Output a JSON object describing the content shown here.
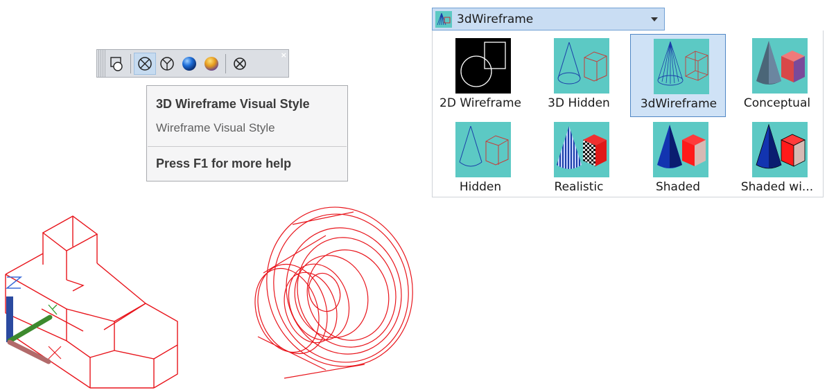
{
  "toolbar": {
    "buttons": [
      "2d-wireframe",
      "3d-wireframe",
      "3d-hidden",
      "realistic",
      "conceptual",
      "manage-visual-styles"
    ],
    "close_glyph": "×"
  },
  "tooltip": {
    "title": "3D Wireframe Visual Style",
    "description": "Wireframe Visual Style",
    "help": "Press F1 for more help"
  },
  "dropdown": {
    "selected": "3dWireframe"
  },
  "gallery": {
    "items": [
      {
        "label": "2D Wireframe"
      },
      {
        "label": "3D Hidden"
      },
      {
        "label": "3dWireframe",
        "selected": true
      },
      {
        "label": "Conceptual"
      },
      {
        "label": "Hidden"
      },
      {
        "label": "Realistic"
      },
      {
        "label": "Shaded"
      },
      {
        "label": "Shaded wi..."
      }
    ]
  },
  "colors": {
    "wireframe": "#e8141b",
    "thumb_bg": "#5cc9c4",
    "selection": "#cfe2f6",
    "selection_border": "#4f86c4"
  }
}
